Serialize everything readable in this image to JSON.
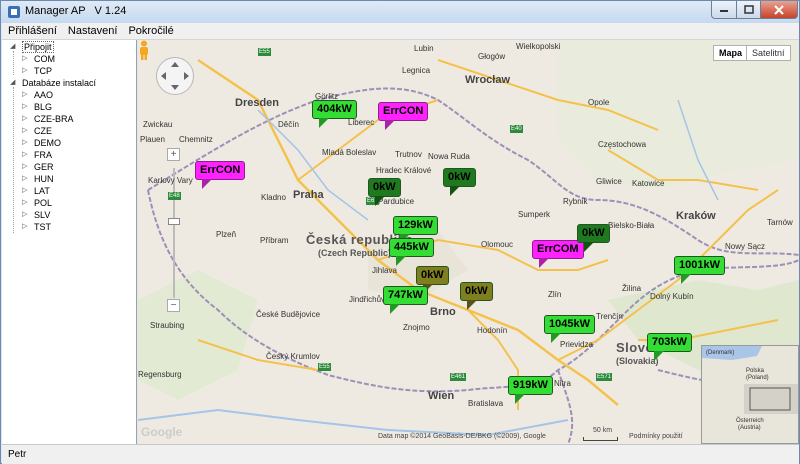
{
  "window": {
    "title": "Manager AP   V 1.24",
    "controls": {
      "minimize": "–",
      "maximize": "□",
      "close": "✕"
    }
  },
  "menu": [
    "Přihlášení",
    "Nastavení",
    "Pokročilé"
  ],
  "tree": {
    "connect": {
      "label": "Připojit",
      "children": [
        "COM",
        "TCP"
      ]
    },
    "database": {
      "label": "Databáze instalací",
      "children": [
        "AAO",
        "BLG",
        "CZE-BRA",
        "CZE",
        "DEMO",
        "FRA",
        "GER",
        "HUN",
        "LAT",
        "POL",
        "SLV",
        "TST"
      ]
    }
  },
  "map": {
    "type_buttons": {
      "map": "Mapa",
      "satellite": "Satelitní"
    },
    "zoom_plus": "+",
    "zoom_minus": "−",
    "country_cz": "Česká republika",
    "country_cz_sub": "(Czech Republic)",
    "country_sk": "Slovensko",
    "country_sk_sub": "(Slovakia)",
    "credit": "Data map ©2014 GeoBasis-DE/BKG (©2009), Google",
    "scale": "50 km",
    "terms": "Podmínky použití",
    "google": "Google",
    "inset": {
      "labels": [
        "(Denmark)",
        "Polska",
        "(Poland)",
        "Österreich",
        "(Austria)"
      ]
    },
    "cities": [
      {
        "name": "Lubin"
      },
      {
        "name": "Wielkopolski"
      },
      {
        "name": "Głogów"
      },
      {
        "name": "Legnica"
      },
      {
        "name": "Wrocław"
      },
      {
        "name": "Dresden"
      },
      {
        "name": "Görlitz"
      },
      {
        "name": "Chemnitz"
      },
      {
        "name": "Děčín"
      },
      {
        "name": "Liberec"
      },
      {
        "name": "Mladá Boleslav"
      },
      {
        "name": "Trutnov"
      },
      {
        "name": "Nowa Ruda"
      },
      {
        "name": "Karlovy Vary"
      },
      {
        "name": "Praha"
      },
      {
        "name": "Kladno"
      },
      {
        "name": "Hradec Králové"
      },
      {
        "name": "Pardubice"
      },
      {
        "name": "Plzeň"
      },
      {
        "name": "Příbram"
      },
      {
        "name": "Jihlava"
      },
      {
        "name": "Olomouc"
      },
      {
        "name": "Brno"
      },
      {
        "name": "Zlín"
      },
      {
        "name": "Opole"
      },
      {
        "name": "Gliwice"
      },
      {
        "name": "Katowice"
      },
      {
        "name": "Kraków"
      },
      {
        "name": "Bielsko-Biała"
      },
      {
        "name": "Tarnów"
      },
      {
        "name": "Nowy Sącz"
      },
      {
        "name": "Žilina"
      },
      {
        "name": "Dolný Kubín"
      },
      {
        "name": "Prievidza"
      },
      {
        "name": "Nitra"
      },
      {
        "name": "Wien"
      },
      {
        "name": "Bratislava"
      },
      {
        "name": "Znojmo"
      },
      {
        "name": "Hodonín"
      },
      {
        "name": "České Budějovice"
      },
      {
        "name": "Český Krumlov"
      },
      {
        "name": "Straubing"
      },
      {
        "name": "Regensburg"
      },
      {
        "name": "Jindřichův Hradec"
      },
      {
        "name": "Plauen"
      },
      {
        "name": "Zwickau"
      },
      {
        "name": "Częstochowa"
      },
      {
        "name": "Rybnik"
      },
      {
        "name": "Trenčín"
      },
      {
        "name": "Sumperk"
      }
    ],
    "markers": [
      {
        "label": "404kW",
        "color": "green"
      },
      {
        "label": "ErrCON",
        "color": "magenta"
      },
      {
        "label": "ErrCON",
        "color": "magenta"
      },
      {
        "label": "0kW",
        "color": "dkgreen"
      },
      {
        "label": "0kW",
        "color": "dkgreen"
      },
      {
        "label": "129kW",
        "color": "green"
      },
      {
        "label": "445kW",
        "color": "green"
      },
      {
        "label": "0kW",
        "color": "olive"
      },
      {
        "label": "747kW",
        "color": "green"
      },
      {
        "label": "0kW",
        "color": "olive"
      },
      {
        "label": "ErrCOM",
        "color": "magenta"
      },
      {
        "label": "0kW",
        "color": "dkgreen"
      },
      {
        "label": "1001kW",
        "color": "green"
      },
      {
        "label": "1045kW",
        "color": "green"
      },
      {
        "label": "703kW",
        "color": "green"
      },
      {
        "label": "919kW",
        "color": "green"
      }
    ]
  },
  "status": {
    "user": "Petr"
  }
}
